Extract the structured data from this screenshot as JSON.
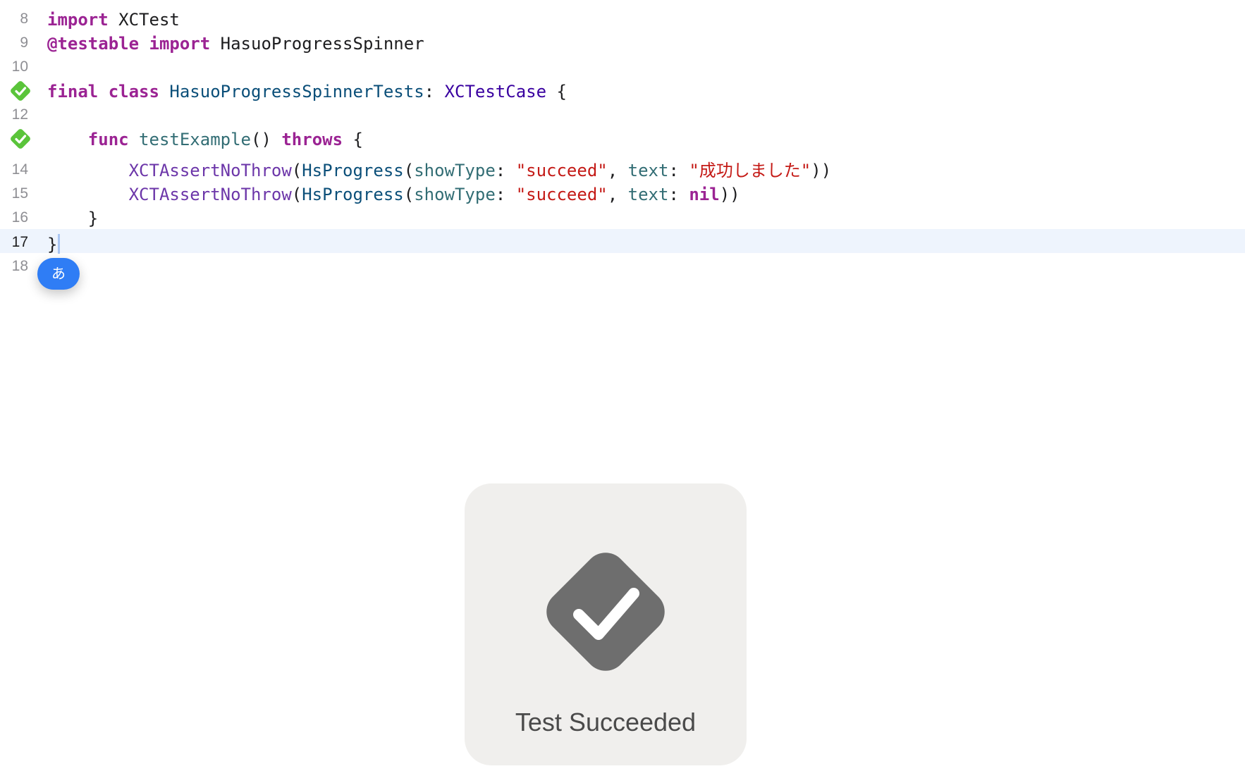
{
  "editor": {
    "lines": [
      {
        "number": "8",
        "tokens": [
          "import",
          " ",
          "XCTest"
        ]
      },
      {
        "number": "9",
        "tokens": [
          "@testable",
          " ",
          "import",
          " ",
          "HasuoProgressSpinner"
        ]
      },
      {
        "number": "10",
        "tokens": []
      },
      {
        "number": "11",
        "tokens": [
          "final",
          " ",
          "class",
          " ",
          "HasuoProgressSpinnerTests",
          ": ",
          "XCTestCase",
          " {"
        ]
      },
      {
        "number": "12",
        "tokens": []
      },
      {
        "number": "13",
        "tokens": [
          "    ",
          "func",
          " ",
          "testExample",
          "() ",
          "throws",
          " {"
        ]
      },
      {
        "number": "14",
        "tokens": [
          "        ",
          "XCTAssertNoThrow",
          "(",
          "HsProgress",
          "(",
          "showType",
          ": ",
          "\"succeed\"",
          ", ",
          "text",
          ": ",
          "\"成功しました\"",
          "))"
        ]
      },
      {
        "number": "15",
        "tokens": [
          "        ",
          "XCTAssertNoThrow",
          "(",
          "HsProgress",
          "(",
          "showType",
          ": ",
          "\"succeed\"",
          ", ",
          "text",
          ": ",
          "nil",
          "))"
        ]
      },
      {
        "number": "16",
        "tokens": [
          "    }"
        ]
      },
      {
        "number": "17",
        "tokens": [
          "}"
        ]
      },
      {
        "number": "18",
        "tokens": []
      }
    ],
    "test_status_icon": "checkmark-diamond-icon",
    "test_status_color": "#5ac43a",
    "current_line_highlight": "#eef4fd"
  },
  "ime": {
    "label": "あ",
    "color": "#2f7df5"
  },
  "hud": {
    "icon": "checkmark-diamond-icon",
    "icon_color": "#6e6e6e",
    "message": "Test Succeeded"
  }
}
